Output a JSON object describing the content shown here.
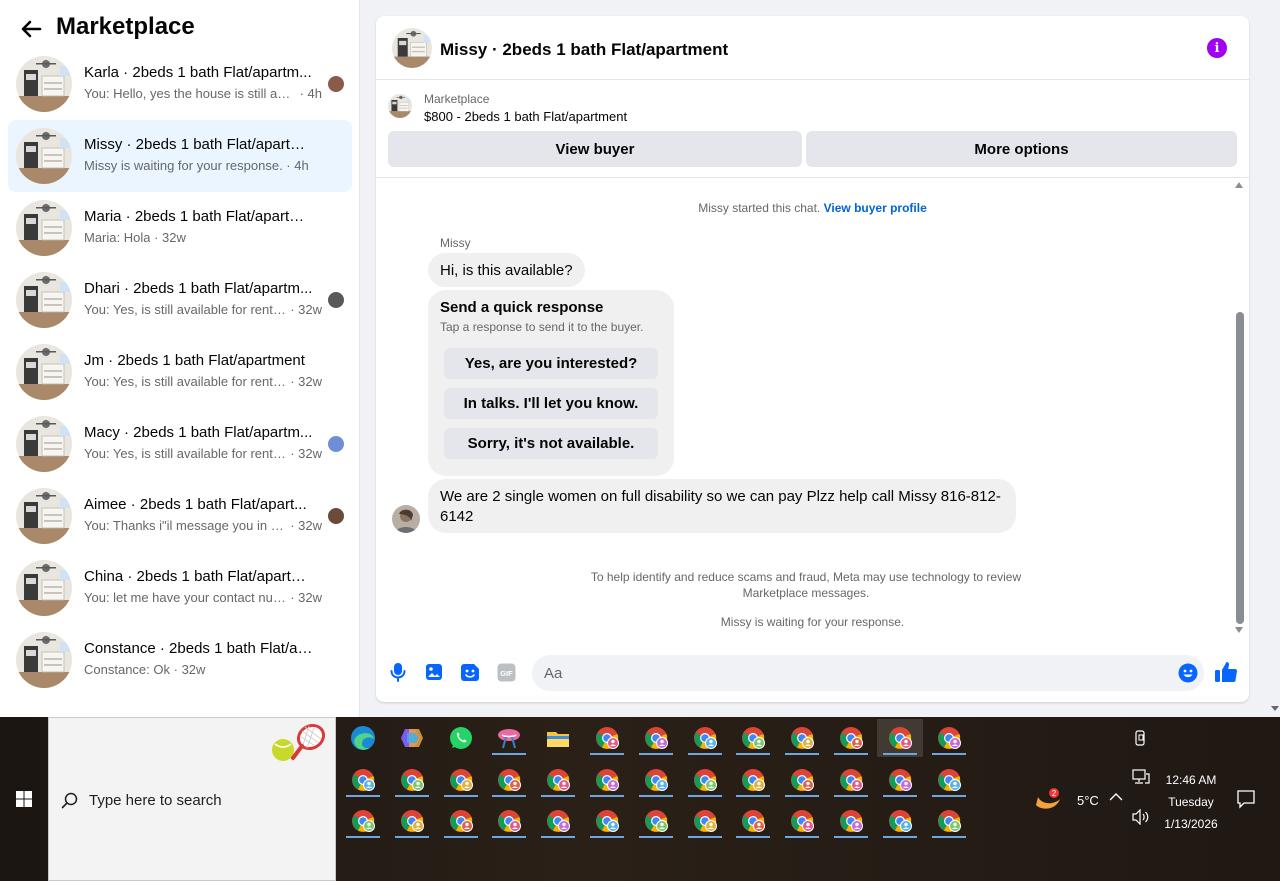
{
  "sidebar": {
    "title": "Marketplace",
    "conversations": [
      {
        "name": "Karla · 2beds 1 bath Flat/apartm...",
        "snippet": "You: Hello, yes the house is still ava...",
        "time": "4h",
        "seen_color": "#8b5a4a",
        "active": false
      },
      {
        "name": "Missy · 2beds 1 bath Flat/apartment",
        "snippet": "Missy is waiting for your response.",
        "time": "4h",
        "seen_color": "",
        "active": true
      },
      {
        "name": "Maria · 2beds 1 bath Flat/apartment",
        "snippet": "Maria: Hola",
        "time": "32w",
        "seen_color": "",
        "active": false
      },
      {
        "name": "Dhari · 2beds 1 bath Flat/apartm...",
        "snippet": "You: Yes, is still available for rent. ...",
        "time": "32w",
        "seen_color": "#5a5a5a",
        "active": false
      },
      {
        "name": "Jm · 2beds 1 bath Flat/apartment",
        "snippet": "You: Yes, is still available for rent. Ple...",
        "time": "32w",
        "seen_color": "",
        "active": false
      },
      {
        "name": "Macy · 2beds 1 bath Flat/apartm...",
        "snippet": "You: Yes, is still available for rent. ...",
        "time": "32w",
        "seen_color": "#6f8ed6",
        "active": false
      },
      {
        "name": "Aimee · 2beds 1 bath Flat/apart...",
        "snippet": "You: Thanks i\"il message you in a ...",
        "time": "32w",
        "seen_color": "#6b4a3a",
        "active": false
      },
      {
        "name": "China · 2beds 1 bath Flat/apartment",
        "snippet": "You: let me have your contact numb...",
        "time": "32w",
        "seen_color": "",
        "active": false
      },
      {
        "name": "Constance · 2beds 1 bath Flat/apar...",
        "snippet": "Constance: Ok",
        "time": "32w",
        "seen_color": "",
        "active": false
      }
    ]
  },
  "chat": {
    "title": "Missy · 2beds 1 bath Flat/apartment",
    "listing_label": "Marketplace",
    "listing_price": "$800 - 2beds 1 bath Flat/apartment",
    "view_buyer": "View buyer",
    "more_options": "More options",
    "started_text": "Missy started this chat.",
    "view_profile_link": "View buyer profile",
    "sender": "Missy",
    "msg1": "Hi, is this available?",
    "quick_title": "Send a quick response",
    "quick_sub": "Tap a response to send it to the buyer.",
    "quick_options": [
      "Yes, are you interested?",
      "In talks. I'll let you know.",
      "Sorry, it's not available."
    ],
    "msg2": "We are 2 single women on full disability so we can pay Plzz help call Missy 816-812-6142",
    "meta_notice": "To help identify and reduce scams and fraud, Meta may use technology to review Marketplace messages.",
    "waiting_text": "Missy is waiting for your response.",
    "input_placeholder": "Aa",
    "accent": "#0866ff",
    "info_color": "#a100f2"
  },
  "taskbar": {
    "search_placeholder": "Type here to search",
    "weather": "5°C",
    "time": "12:46 AM",
    "day": "Tuesday",
    "date": "1/13/2026",
    "notification_badge": "2"
  }
}
